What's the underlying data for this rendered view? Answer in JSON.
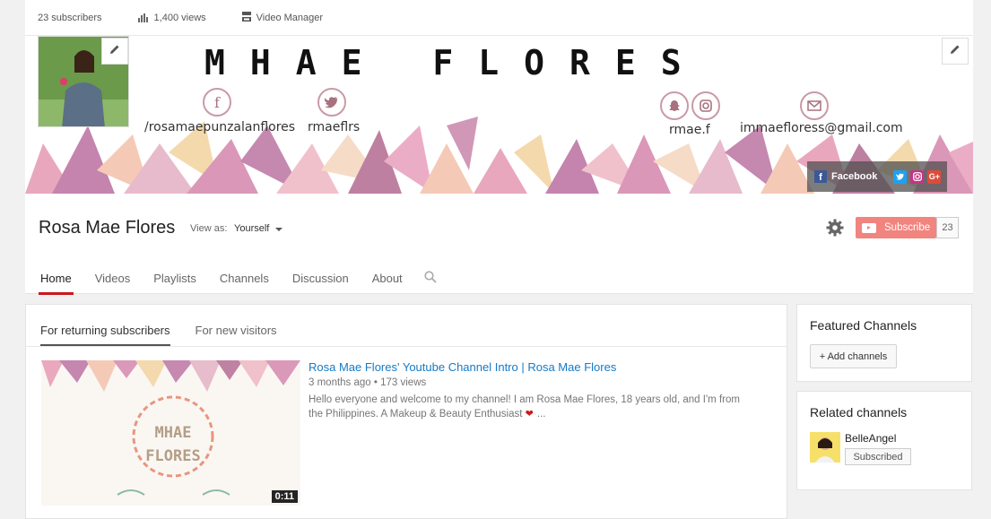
{
  "stats": {
    "subscribers": "23 subscribers",
    "views": "1,400 views",
    "video_manager": "Video Manager"
  },
  "banner": {
    "title": "MHAE FLORES",
    "social": {
      "facebook_handle": "/rosamaepunzalanflores",
      "twitter_handle": "rmaeflrs",
      "snap_insta_handle": "rmae.f",
      "email": "immaefloress@gmail.com"
    },
    "links": {
      "facebook_label": "Facebook"
    },
    "colors": {
      "pink": "#e8a0b8",
      "mauve": "#c07aa8",
      "peach": "#f4c6b0",
      "gold": "#f3d6a6"
    }
  },
  "channel": {
    "name": "Rosa Mae Flores",
    "view_as_label": "View as:",
    "view_as_value": "Yourself",
    "subscribe_label": "Subscribe",
    "subscribe_count": "23",
    "tabs": [
      {
        "label": "Home",
        "active": true
      },
      {
        "label": "Videos"
      },
      {
        "label": "Playlists"
      },
      {
        "label": "Channels"
      },
      {
        "label": "Discussion"
      },
      {
        "label": "About"
      }
    ]
  },
  "main": {
    "sub_tabs": [
      {
        "label": "For returning subscribers",
        "active": true
      },
      {
        "label": "For new visitors"
      }
    ],
    "video": {
      "title": "Rosa Mae Flores' Youtube Channel Intro | Rosa Mae Flores",
      "age": "3 months ago",
      "views": "173 views",
      "description": "Hello everyone and welcome to my channel! I am Rosa Mae Flores, 18 years old, and I'm from the Philippines. A Makeup & Beauty Enthusiast",
      "desc_suffix": "...",
      "duration": "0:11",
      "thumb_text_1": "MHAE",
      "thumb_text_2": "FLORES"
    }
  },
  "sidebar": {
    "featured_title": "Featured Channels",
    "add_channels": "+ Add channels",
    "related_title": "Related channels",
    "related": [
      {
        "name": "BelleAngel",
        "button": "Subscribed"
      }
    ]
  }
}
